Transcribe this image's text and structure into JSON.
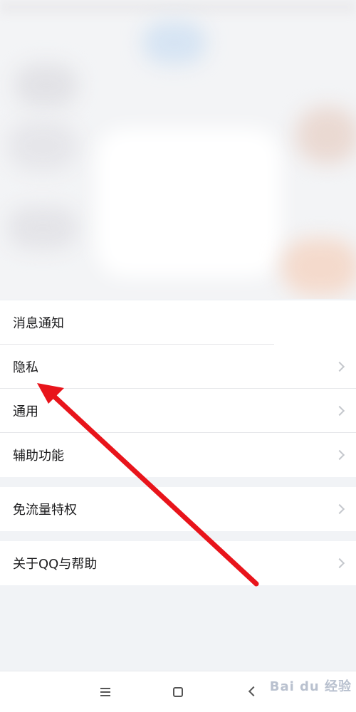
{
  "settings": {
    "items": [
      {
        "label": "消息通知",
        "has_chevron": false
      },
      {
        "label": "隐私",
        "has_chevron": true
      },
      {
        "label": "通用",
        "has_chevron": true
      },
      {
        "label": "辅助功能",
        "has_chevron": true
      },
      {
        "label": "免流量特权",
        "has_chevron": true
      },
      {
        "label": "关于QQ与帮助",
        "has_chevron": true
      }
    ]
  },
  "navbar": {
    "buttons": [
      "menu-icon",
      "home-icon",
      "back-icon"
    ]
  },
  "watermark": {
    "text": "Bai du 经验"
  },
  "colors": {
    "annotation_arrow": "#e8141b",
    "row_background": "#ffffff",
    "page_background": "#f1f3f6",
    "chevron": "#c4c7cc"
  }
}
